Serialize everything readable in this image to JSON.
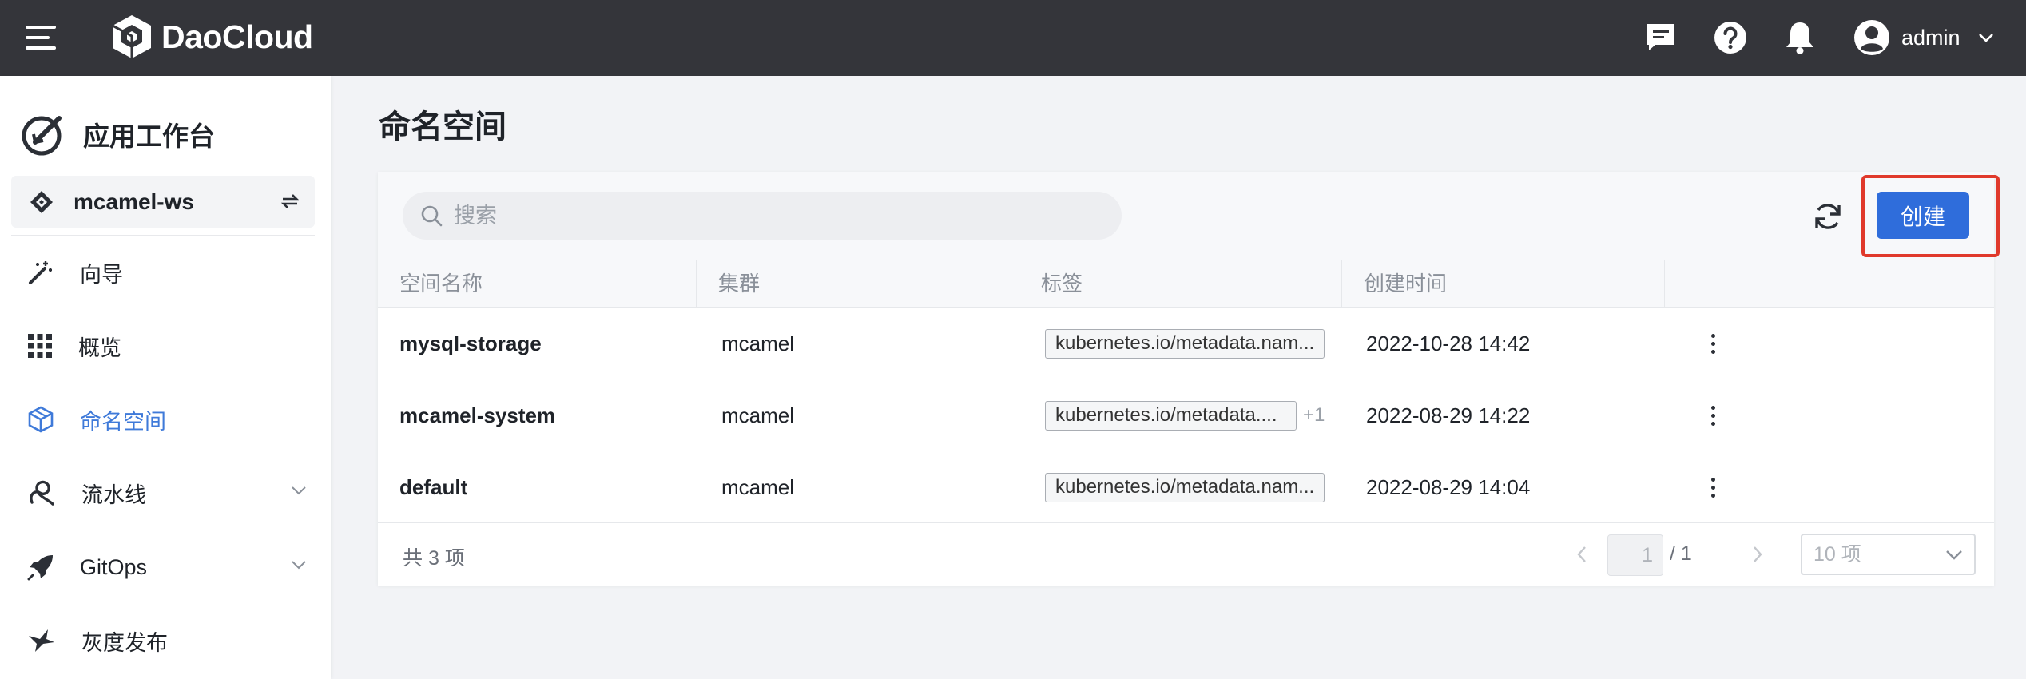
{
  "topbar": {
    "brand": "DaoCloud",
    "icons": [
      "hamburger-menu-icon",
      "message-icon",
      "help-icon",
      "bell-icon",
      "user-avatar-icon",
      "chevron-down-icon"
    ],
    "user_name": "admin"
  },
  "sidebar": {
    "app_title": "应用工作台",
    "workspace": "mcamel-ws",
    "items": [
      {
        "label": "向导",
        "icon": "wand-icon",
        "active": false
      },
      {
        "label": "概览",
        "icon": "grid-icon",
        "active": false
      },
      {
        "label": "命名空间",
        "icon": "cube-icon",
        "active": true
      },
      {
        "label": "流水线",
        "icon": "pipeline-icon",
        "active": false,
        "expandable": true
      },
      {
        "label": "GitOps",
        "icon": "rocket-icon",
        "active": false,
        "expandable": true
      },
      {
        "label": "灰度发布",
        "icon": "bird-icon",
        "active": false
      }
    ]
  },
  "main": {
    "title": "命名空间",
    "search_placeholder": "搜索",
    "create_label": "创建",
    "columns": [
      "空间名称",
      "集群",
      "标签",
      "创建时间"
    ],
    "rows": [
      {
        "name": "mysql-storage",
        "cluster": "mcamel",
        "tag": "kubernetes.io/metadata.nam...",
        "tag_more": "",
        "created": "2022-10-28 14:42"
      },
      {
        "name": "mcamel-system",
        "cluster": "mcamel",
        "tag": "kubernetes.io/metadata....",
        "tag_more": "+1",
        "created": "2022-08-29 14:22"
      },
      {
        "name": "default",
        "cluster": "mcamel",
        "tag": "kubernetes.io/metadata.nam...",
        "tag_more": "",
        "created": "2022-08-29 14:04"
      }
    ],
    "pagination": {
      "total_label": "共 3 项",
      "current_page": "1",
      "total_pages": "/ 1",
      "page_size": "10 项"
    }
  },
  "colors": {
    "topbar": "#34353a",
    "accent": "#2f6ddb",
    "active_nav": "#3f7ad9",
    "highlight": "#e0392b"
  }
}
